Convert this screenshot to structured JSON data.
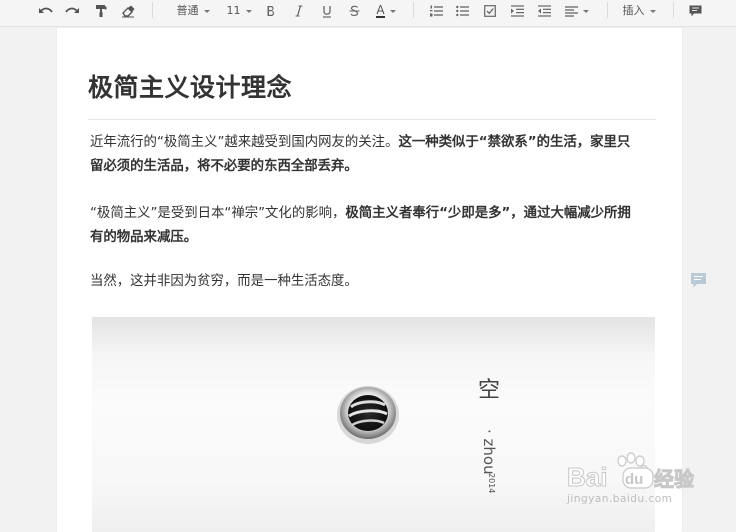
{
  "toolbar": {
    "paragraph_style": "普通",
    "font_size": "11",
    "insert_label": "插入",
    "font_color_letter": "A",
    "text_color": "#333333"
  },
  "document": {
    "title": "极简主义设计理念",
    "paragraphs": [
      {
        "line1": {
          "normal": "近年流行的“极简主义”越来越受到国内网友的关注。",
          "bold": "这一种类似于“禁欲系”的生活，家里只"
        },
        "line2": {
          "bold": "留必须的生活品，将不必要的东西全部丢弃。"
        }
      },
      {
        "line1": {
          "normal": "“极简主义”是受到日本“禅宗”文化的影响，",
          "bold": "极简主义者奉行“少即是多”，通过大幅减少所拥"
        },
        "line2": {
          "bold": "有的物品来减压。"
        }
      },
      {
        "line1": {
          "normal": "当然，这并非因为贫穷，而是一种生活态度。"
        }
      }
    ],
    "image": {
      "caption_char": "空",
      "caption_name": "· zhou",
      "caption_year": "2014"
    }
  },
  "watermark": {
    "site": "jingyan.baidu.com",
    "logo_text_left": "Bai",
    "logo_text_right": "du",
    "logo_suffix": "经验"
  }
}
